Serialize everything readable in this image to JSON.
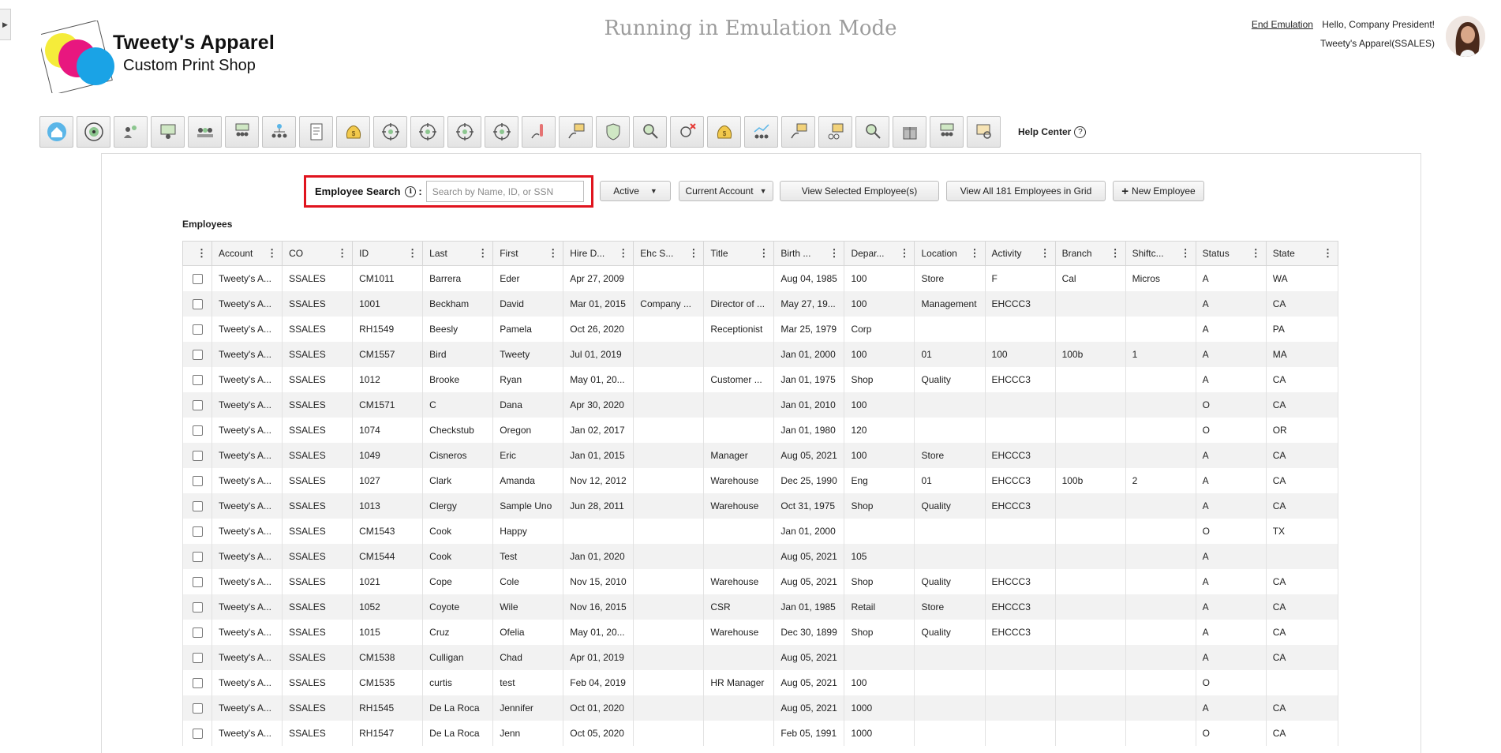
{
  "header": {
    "company_name": "Tweety's Apparel",
    "company_tagline": "Custom Print Shop",
    "emulation_title": "Running in Emulation Mode",
    "end_emulation_link": "End Emulation",
    "greeting": "Hello, Company President!",
    "account_label": "Tweety's Apparel(SSALES)"
  },
  "toolbar": {
    "icons": [
      "home-icon",
      "target-icon",
      "people-gear-icon",
      "presentation-icon",
      "team-icon",
      "group-board-icon",
      "org-chart-icon",
      "document-icon",
      "money-bag-icon",
      "crosshair-icon",
      "crosshair-icon",
      "crosshair-icon",
      "crosshair-icon",
      "thermometer-hand-icon",
      "hand-board-icon",
      "shield-icon",
      "magnify-hand-icon",
      "search-cancel-icon",
      "money-bag-icon",
      "chart-people-icon",
      "hand-board-icon",
      "board-coins-icon",
      "magnify-hand-icon",
      "gift-icon",
      "group-board-icon",
      "certificate-search-icon"
    ],
    "help_label": "Help Center",
    "help_symbol": "?"
  },
  "search": {
    "label": "Employee Search",
    "info_symbol": "i",
    "colon": ":",
    "placeholder": "Search by Name, ID, or SSN",
    "status_filter": "Active",
    "account_filter": "Current Account",
    "view_selected": "View Selected Employee(s)",
    "view_all": "View All 181 Employees in Grid",
    "new_employee": "New Employee",
    "plus_symbol": "+"
  },
  "grid": {
    "section_title": "Employees",
    "columns": [
      "Account",
      "CO",
      "ID",
      "Last",
      "First",
      "Hire D...",
      "Ehc S...",
      "Title",
      "Birth ...",
      "Depar...",
      "Location",
      "Activity",
      "Branch",
      "Shiftc...",
      "Status",
      "State"
    ],
    "rows": [
      [
        "Tweety's A...",
        "SSALES",
        "CM1011",
        "Barrera",
        "Eder",
        "Apr 27, 2009",
        "",
        "",
        "Aug 04, 1985",
        "100",
        "Store",
        "F",
        "Cal",
        "Micros",
        "A",
        "WA"
      ],
      [
        "Tweety's A...",
        "SSALES",
        "1001",
        "Beckham",
        "David",
        "Mar 01, 2015",
        "Company ...",
        "Director of ...",
        "May 27, 19...",
        "100",
        "Management",
        "EHCCC3",
        "",
        "",
        "A",
        "CA"
      ],
      [
        "Tweety's A...",
        "SSALES",
        "RH1549",
        "Beesly",
        "Pamela",
        "Oct 26, 2020",
        "",
        "Receptionist",
        "Mar 25, 1979",
        "Corp",
        "",
        "",
        "",
        "",
        "A",
        "PA"
      ],
      [
        "Tweety's A...",
        "SSALES",
        "CM1557",
        "Bird",
        "Tweety",
        "Jul 01, 2019",
        "",
        "",
        "Jan 01, 2000",
        "100",
        "01",
        "100",
        "100b",
        "1",
        "A",
        "MA"
      ],
      [
        "Tweety's A...",
        "SSALES",
        "1012",
        "Brooke",
        "Ryan",
        "May 01, 20...",
        "",
        "Customer ...",
        "Jan 01, 1975",
        "Shop",
        "Quality",
        "EHCCC3",
        "",
        "",
        "A",
        "CA"
      ],
      [
        "Tweety's A...",
        "SSALES",
        "CM1571",
        "C",
        "Dana",
        "Apr 30, 2020",
        "",
        "",
        "Jan 01, 2010",
        "100",
        "",
        "",
        "",
        "",
        "O",
        "CA"
      ],
      [
        "Tweety's A...",
        "SSALES",
        "1074",
        "Checkstub",
        "Oregon",
        "Jan 02, 2017",
        "",
        "",
        "Jan 01, 1980",
        "120",
        "",
        "",
        "",
        "",
        "O",
        "OR"
      ],
      [
        "Tweety's A...",
        "SSALES",
        "1049",
        "Cisneros",
        "Eric",
        "Jan 01, 2015",
        "",
        "Manager",
        "Aug 05, 2021",
        "100",
        "Store",
        "EHCCC3",
        "",
        "",
        "A",
        "CA"
      ],
      [
        "Tweety's A...",
        "SSALES",
        "1027",
        "Clark",
        "Amanda",
        "Nov 12, 2012",
        "",
        "Warehouse",
        "Dec 25, 1990",
        "Eng",
        "01",
        "EHCCC3",
        "100b",
        "2",
        "A",
        "CA"
      ],
      [
        "Tweety's A...",
        "SSALES",
        "1013",
        "Clergy",
        "Sample Uno",
        "Jun 28, 2011",
        "",
        "Warehouse",
        "Oct 31, 1975",
        "Shop",
        "Quality",
        "EHCCC3",
        "",
        "",
        "A",
        "CA"
      ],
      [
        "Tweety's A...",
        "SSALES",
        "CM1543",
        "Cook",
        "Happy",
        "",
        "",
        "",
        "Jan 01, 2000",
        "",
        "",
        "",
        "",
        "",
        "O",
        "TX"
      ],
      [
        "Tweety's A...",
        "SSALES",
        "CM1544",
        "Cook",
        "Test",
        "Jan 01, 2020",
        "",
        "",
        "Aug 05, 2021",
        "105",
        "",
        "",
        "",
        "",
        "A",
        ""
      ],
      [
        "Tweety's A...",
        "SSALES",
        "1021",
        "Cope",
        "Cole",
        "Nov 15, 2010",
        "",
        "Warehouse",
        "Aug 05, 2021",
        "Shop",
        "Quality",
        "EHCCC3",
        "",
        "",
        "A",
        "CA"
      ],
      [
        "Tweety's A...",
        "SSALES",
        "1052",
        "Coyote",
        "Wile",
        "Nov 16, 2015",
        "",
        "CSR",
        "Jan 01, 1985",
        "Retail",
        "Store",
        "EHCCC3",
        "",
        "",
        "A",
        "CA"
      ],
      [
        "Tweety's A...",
        "SSALES",
        "1015",
        "Cruz",
        "Ofelia",
        "May 01, 20...",
        "",
        "Warehouse",
        "Dec 30, 1899",
        "Shop",
        "Quality",
        "EHCCC3",
        "",
        "",
        "A",
        "CA"
      ],
      [
        "Tweety's A...",
        "SSALES",
        "CM1538",
        "Culligan",
        "Chad",
        "Apr 01, 2019",
        "",
        "",
        "Aug 05, 2021",
        "",
        "",
        "",
        "",
        "",
        "A",
        "CA"
      ],
      [
        "Tweety's A...",
        "SSALES",
        "CM1535",
        "curtis",
        "test",
        "Feb 04, 2019",
        "",
        "HR Manager",
        "Aug 05, 2021",
        "100",
        "",
        "",
        "",
        "",
        "O",
        ""
      ],
      [
        "Tweety's A...",
        "SSALES",
        "RH1545",
        "De La Roca",
        "Jennifer",
        "Oct 01, 2020",
        "",
        "",
        "Aug 05, 2021",
        "1000",
        "",
        "",
        "",
        "",
        "A",
        "CA"
      ],
      [
        "Tweety's A...",
        "SSALES",
        "RH1547",
        "De La Roca",
        "Jenn",
        "Oct 05, 2020",
        "",
        "",
        "Feb 05, 1991",
        "1000",
        "",
        "",
        "",
        "",
        "O",
        "CA"
      ]
    ]
  },
  "colors": {
    "highlight_border": "#e0141e",
    "logo_yellow": "#f5ec3a",
    "logo_magenta": "#e8177f",
    "logo_cyan": "#1aa3e6",
    "emulation_text": "#9c9c9c",
    "row_stripe": "#f2f2f2"
  }
}
